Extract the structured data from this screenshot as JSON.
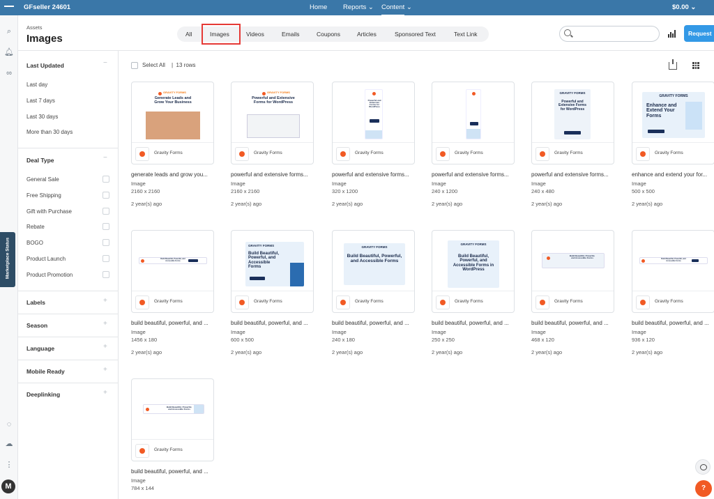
{
  "app": {
    "account": "GFseller 24601",
    "balance": "$0.00"
  },
  "topnav": {
    "home": "Home",
    "reports": "Reports",
    "content": "Content"
  },
  "page": {
    "breadcrumb": "Assets",
    "title": "Images",
    "marketplace_status": "Marketplace Status"
  },
  "tabs": [
    "All",
    "Images",
    "Videos",
    "Emails",
    "Coupons",
    "Articles",
    "Sponsored Text",
    "Text Link"
  ],
  "active_tab": "Images",
  "search": {
    "placeholder": ""
  },
  "request_button": "Request",
  "filters": {
    "last_updated": {
      "title": "Last Updated",
      "options": [
        "Last day",
        "Last 7 days",
        "Last 30 days",
        "More than 30 days"
      ]
    },
    "deal_type": {
      "title": "Deal Type",
      "options": [
        "General Sale",
        "Free Shipping",
        "Gift with Purchase",
        "Rebate",
        "BOGO",
        "Product Launch",
        "Product Promotion"
      ]
    },
    "collapsed": [
      "Labels",
      "Season",
      "Language",
      "Mobile Ready",
      "Deeplinking"
    ]
  },
  "toolbar": {
    "select_all": "Select All",
    "separator": "|",
    "rows": "13 rows"
  },
  "assets": [
    {
      "name": "generate leads and grow you...",
      "type": "Image",
      "size": "2160 x 2160",
      "age": "2 year(s) ago",
      "seller": "Gravity Forms",
      "headline": "Generate Leads and Grow Your Business",
      "brand": "GRAVITY FORMS"
    },
    {
      "name": "powerful and extensive forms...",
      "type": "Image",
      "size": "2160 x 2160",
      "age": "2 year(s) ago",
      "seller": "Gravity Forms",
      "headline": "Powerful and Extensive Forms for WordPress",
      "brand": "GRAVITY FORMS"
    },
    {
      "name": "powerful and extensive forms...",
      "type": "Image",
      "size": "320 x 1200",
      "age": "2 year(s) ago",
      "seller": "Gravity Forms",
      "headline": "Powerful and Extensive Forms for WordPress"
    },
    {
      "name": "powerful and extensive forms...",
      "type": "Image",
      "size": "240 x 1200",
      "age": "2 year(s) ago",
      "seller": "Gravity Forms",
      "headline": ""
    },
    {
      "name": "powerful and extensive forms...",
      "type": "Image",
      "size": "240 x 480",
      "age": "2 year(s) ago",
      "seller": "Gravity Forms",
      "headline": "Powerful and Extensive Forms for WordPress",
      "brand": "GRAVITY FORMS",
      "cta": "Learn More"
    },
    {
      "name": "enhance and extend your for...",
      "type": "Image",
      "size": "500 x 500",
      "age": "2 year(s) ago",
      "seller": "Gravity Forms",
      "headline": "Enhance and Extend Your Forms",
      "brand": "GRAVITY FORMS",
      "cta": "Learn More"
    },
    {
      "name": "build beautiful, powerful, and ...",
      "type": "Image",
      "size": "1456 x 180",
      "age": "2 year(s) ago",
      "seller": "Gravity Forms",
      "headline": "Build Beautiful, Powerful, and Accessible Forms"
    },
    {
      "name": "build beautiful, powerful, and ...",
      "type": "Image",
      "size": "600 x 500",
      "age": "2 year(s) ago",
      "seller": "Gravity Forms",
      "headline": "Build Beautiful, Powerful, and Accessible Forms",
      "brand": "GRAVITY FORMS",
      "cta": "Learn More"
    },
    {
      "name": "build beautiful, powerful, and ...",
      "type": "Image",
      "size": "240 x 180",
      "age": "2 year(s) ago",
      "seller": "Gravity Forms",
      "headline": "Build Beautiful, Powerful, and Accessible Forms",
      "brand": "GRAVITY FORMS"
    },
    {
      "name": "build beautiful, powerful, and ...",
      "type": "Image",
      "size": "250 x 250",
      "age": "2 year(s) ago",
      "seller": "Gravity Forms",
      "headline": "Build Beautiful, Powerful, and Accessible Forms in WordPress",
      "brand": "GRAVITY FORMS"
    },
    {
      "name": "build beautiful, powerful, and ...",
      "type": "Image",
      "size": "468 x 120",
      "age": "2 year(s) ago",
      "seller": "Gravity Forms",
      "headline": "Build Beautiful, Powerful, and Accessible Forms"
    },
    {
      "name": "build beautiful, powerful, and ...",
      "type": "Image",
      "size": "936 x 120",
      "age": "2 year(s) ago",
      "seller": "Gravity Forms",
      "headline": "Build Beautiful, Powerful, and Accessible Forms"
    },
    {
      "name": "build beautiful, powerful, and ...",
      "type": "Image",
      "size": "784 x 144",
      "age": "2 year(s) ago",
      "seller": "Gravity Forms",
      "headline": "Build Beautiful, Powerful, and Accessible Forms"
    }
  ],
  "icons": [
    "menu-icon",
    "search-icon",
    "bell-icon",
    "link-icon",
    "chat-icon",
    "cloud-icon",
    "more-vertical-icon",
    "download-icon",
    "grid-view-icon",
    "bar-chart-icon",
    "chevron-down-icon",
    "help-icon"
  ],
  "colors": {
    "topbar": "#3a77a8",
    "accent": "#f15a24",
    "request": "#3399e6",
    "highlight": "#e53935"
  }
}
